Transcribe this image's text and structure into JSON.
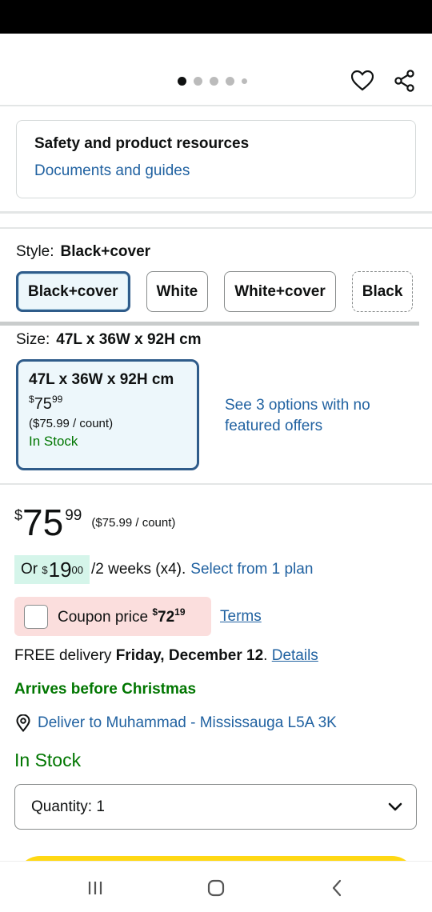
{
  "gallery": {
    "dot_count": 5,
    "active_dot": 0
  },
  "resources": {
    "title": "Safety and product resources",
    "link": "Documents and guides"
  },
  "style": {
    "label": "Style:",
    "selected": "Black+cover",
    "options": [
      "Black+cover",
      "White",
      "White+cover",
      "Black"
    ]
  },
  "size": {
    "label": "Size:",
    "selected": "47L x 36W x 92H cm",
    "card": {
      "title": "47L x 36W x 92H cm",
      "price_symbol": "$",
      "price_whole": "75",
      "price_fraction": "99",
      "unit_price": "($75.99 / count)",
      "stock": "In Stock"
    },
    "other_options": "See 3 options with no featured offers"
  },
  "price": {
    "symbol": "$",
    "whole": "75",
    "fraction": "99",
    "unit_price": "($75.99 / count)"
  },
  "installment": {
    "prefix": "Or",
    "symbol": "$",
    "whole": "19",
    "fraction": "00",
    "period": "/2 weeks (x4).",
    "link": "Select from 1 plan"
  },
  "coupon": {
    "label": "Coupon price",
    "symbol": "$",
    "whole": "72",
    "fraction": "19",
    "terms": "Terms"
  },
  "delivery": {
    "prefix": "FREE delivery",
    "date": "Friday, December 12",
    "suffix": ".",
    "details": "Details"
  },
  "arrives": "Arrives before Christmas",
  "deliver_to": "Deliver to Muhammad - Mississauga L5A 3K",
  "stock": "In Stock",
  "quantity": {
    "label": "Quantity:",
    "value": "1"
  },
  "colors": {
    "link": "#2162a1",
    "in_stock": "#007600",
    "selected_border": "#2f5c8a",
    "coupon_bg": "#fbdedd",
    "installment_bg": "#d5f5ea",
    "cart_button": "#ffd814"
  }
}
